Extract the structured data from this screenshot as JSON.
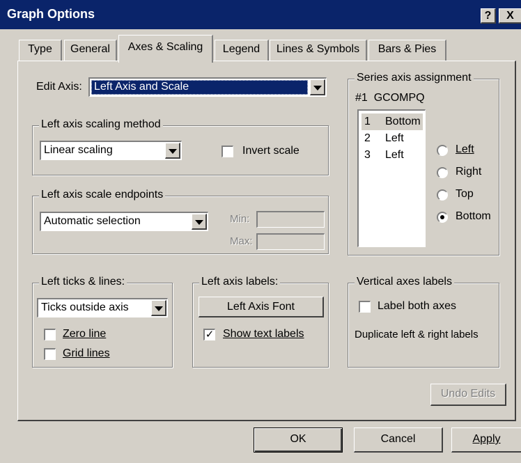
{
  "window": {
    "title": "Graph Options",
    "help_label": "?",
    "close_label": "X"
  },
  "tabs": [
    {
      "label": "Type"
    },
    {
      "label": "General"
    },
    {
      "label": "Axes & Scaling",
      "active": true
    },
    {
      "label": "Legend"
    },
    {
      "label": "Lines & Symbols"
    },
    {
      "label": "Bars & Pies"
    }
  ],
  "edit_axis": {
    "label": "Edit Axis:",
    "value": "Left Axis and Scale"
  },
  "scaling_method": {
    "legend": "Left axis scaling method",
    "value": "Linear scaling",
    "invert_label": "Invert scale",
    "invert_checked": false
  },
  "scale_endpoints": {
    "legend": "Left axis scale endpoints",
    "value": "Automatic selection",
    "min_label": "Min:",
    "max_label": "Max:",
    "min_value": "",
    "max_value": ""
  },
  "series_assignment": {
    "legend": "Series axis assignment",
    "current_series": "#1  GCOMPQ",
    "rows": [
      {
        "num": "1",
        "axis": "Bottom",
        "selected": true
      },
      {
        "num": "2",
        "axis": "Left",
        "selected": false
      },
      {
        "num": "3",
        "axis": "Left",
        "selected": false
      }
    ],
    "options": [
      {
        "label": "Left",
        "checked": false
      },
      {
        "label": "Right",
        "checked": false
      },
      {
        "label": "Top",
        "checked": false
      },
      {
        "label": "Bottom",
        "checked": true
      }
    ]
  },
  "ticks_lines": {
    "legend": "Left ticks & lines:",
    "value": "Ticks outside axis",
    "zero_line_label": "Zero line",
    "zero_line_checked": false,
    "grid_lines_label": "Grid lines",
    "grid_lines_checked": false
  },
  "axis_labels": {
    "legend": "Left axis labels:",
    "font_button": "Left Axis Font",
    "show_text_label": "Show text labels",
    "show_text_checked": true
  },
  "vertical_labels": {
    "legend": "Vertical axes labels",
    "label_both_label": "Label both axes",
    "label_both_checked": false,
    "description": "Duplicate left & right labels"
  },
  "buttons": {
    "undo": "Undo Edits",
    "ok": "OK",
    "cancel": "Cancel",
    "apply": "Apply"
  }
}
